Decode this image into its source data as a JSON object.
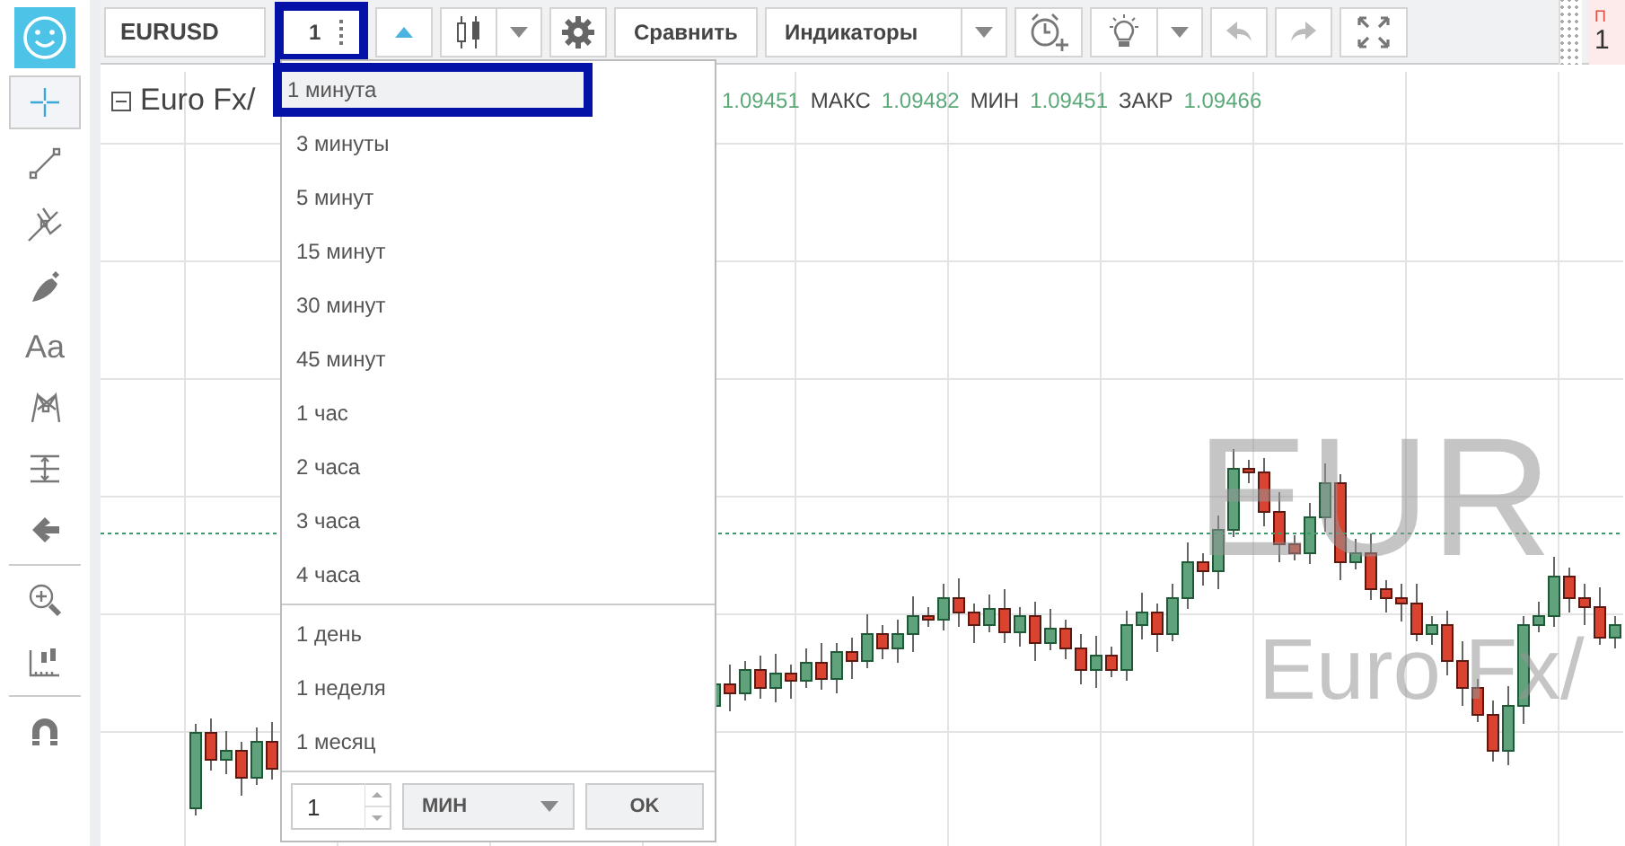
{
  "toolbar": {
    "symbol": "EURUSD",
    "interval": {
      "value": "1",
      "highlighted": true
    },
    "compare": "Сравнить",
    "indicators": "Индикаторы"
  },
  "left_tools": [
    {
      "kind": "crosshair",
      "selected": true
    },
    {
      "kind": "line",
      "selected": false
    },
    {
      "kind": "fork",
      "selected": false
    },
    {
      "kind": "brush",
      "selected": false
    },
    {
      "kind": "text",
      "label": "Aa",
      "selected": false
    },
    {
      "kind": "pattern",
      "selected": false
    },
    {
      "kind": "measure",
      "selected": false
    },
    {
      "kind": "back",
      "selected": false
    },
    {
      "kind": "zoom",
      "selected": false
    },
    {
      "kind": "ruler",
      "selected": false
    },
    {
      "kind": "magnet",
      "selected": false
    }
  ],
  "legend": {
    "title": "Euro Fx/",
    "items": [
      {
        "value": "1.09451"
      },
      {
        "label": "МАКС",
        "value": "1.09482"
      },
      {
        "label": "МИН",
        "value": "1.09451"
      },
      {
        "label": "ЗАКР",
        "value": "1.09466"
      }
    ]
  },
  "chart": {
    "watermark_symbol": "EUR",
    "watermark_name": "Euro Fx/"
  },
  "right_panel": {
    "label": "П",
    "value": "1"
  },
  "interval_menu": {
    "groups": [
      [
        {
          "label": "1 минута",
          "selected": true,
          "highlighted": true
        },
        {
          "label": "3 минуты",
          "selected": false,
          "highlighted": false
        },
        {
          "label": "5 минут",
          "selected": false,
          "highlighted": false
        },
        {
          "label": "15 минут",
          "selected": false,
          "highlighted": false
        },
        {
          "label": "30 минут",
          "selected": false,
          "highlighted": false
        },
        {
          "label": "45 минут",
          "selected": false,
          "highlighted": false
        },
        {
          "label": "1 час",
          "selected": false,
          "highlighted": false
        },
        {
          "label": "2 часа",
          "selected": false,
          "highlighted": false
        },
        {
          "label": "3 часа",
          "selected": false,
          "highlighted": false
        },
        {
          "label": "4 часа",
          "selected": false,
          "highlighted": false
        }
      ],
      [
        {
          "label": "1 день",
          "selected": false,
          "highlighted": false
        },
        {
          "label": "1 неделя",
          "selected": false,
          "highlighted": false
        },
        {
          "label": "1 месяц",
          "selected": false,
          "highlighted": false
        }
      ]
    ],
    "custom": {
      "value": "1",
      "unit": "МИН",
      "button": "OK"
    }
  }
}
